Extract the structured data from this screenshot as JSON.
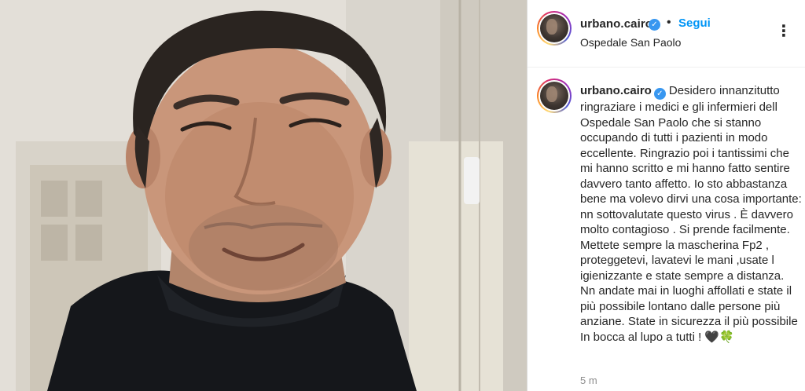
{
  "post": {
    "username": "urbano.cairo",
    "separator": "•",
    "follow_label": "Segui",
    "location": "Ospedale San Paolo",
    "more_label": "⋮",
    "verified_glyph": "✓",
    "caption_text": "Desidero innanzitutto ringraziare i medici e gli infermieri dell Ospedale San Paolo che si stanno occupando di tutti i pazienti in modo eccellente. Ringrazio poi i tantissimi che mi hanno scritto e mi hanno fatto sentire davvero tanto affetto. Io sto abbastanza bene ma volevo dirvi una cosa importante: nn sottovalutate questo virus . È davvero molto contagioso . Si prende facilmente. Mettete sempre la mascherina Fp2 , proteggetevi, lavatevi le mani ,usate l igienizzante e state sempre a distanza. Nn andate mai in luoghi affollati e state il più possibile lontano dalle persone più anziane. State in sicurezza il più possibile In bocca al lupo a tutti ! 🖤🍀",
    "timestamp": "5 m"
  },
  "colors": {
    "link_blue": "#0095f6",
    "verified_blue": "#3897f0",
    "muted_gray": "#8e8e8e"
  },
  "icons": {
    "verified": "verified-badge-icon",
    "more": "more-options-icon"
  }
}
